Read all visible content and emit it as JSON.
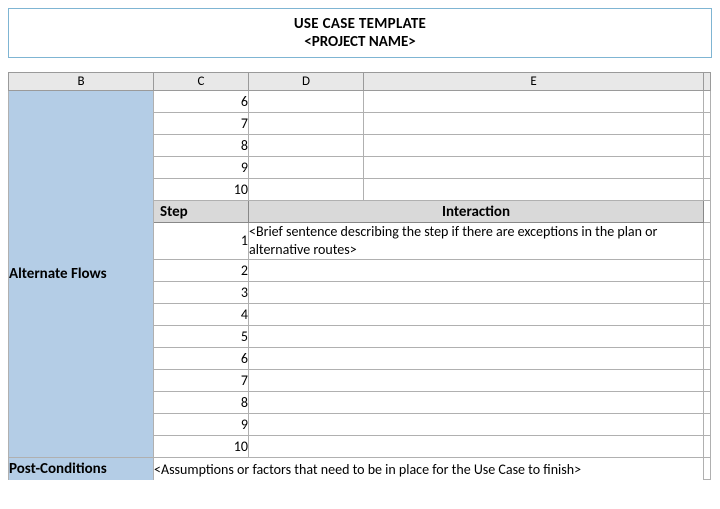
{
  "title": {
    "line1": "USE CASE TEMPLATE",
    "line2": "<PROJECT NAME>"
  },
  "columns": {
    "B": "B",
    "C": "C",
    "D": "D",
    "E": "E"
  },
  "top_steps": [
    "6",
    "7",
    "8",
    "9",
    "10"
  ],
  "subheader": {
    "step": "Step",
    "interaction": "Interaction"
  },
  "alt_flows": {
    "label": "Alternate Flows",
    "first_row": {
      "num": "1",
      "text": "<Brief sentence describing the step if there are exceptions in the plan or alternative routes>"
    },
    "rest": [
      "2",
      "3",
      "4",
      "5",
      "6",
      "7",
      "8",
      "9",
      "10"
    ]
  },
  "post": {
    "label": "Post-Conditions",
    "text": "<Assumptions or factors that need to be in place for the Use Case to finish>"
  }
}
